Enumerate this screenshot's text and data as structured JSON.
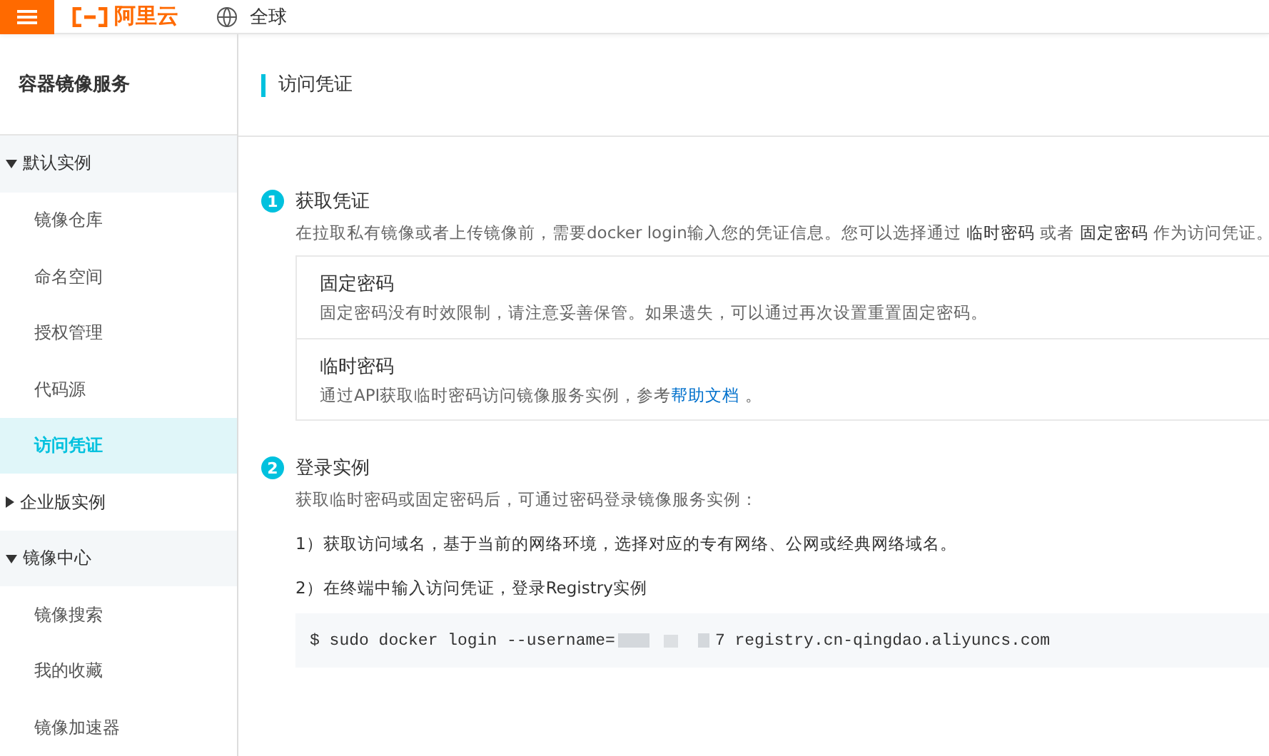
{
  "topbar": {
    "logo": "阿里云",
    "region": "全球"
  },
  "sidebar": {
    "title": "容器镜像服务",
    "groups": [
      {
        "label": "默认实例",
        "expanded": true,
        "children": [
          {
            "label": "镜像仓库",
            "selected": false
          },
          {
            "label": "命名空间",
            "selected": false
          },
          {
            "label": "授权管理",
            "selected": false
          },
          {
            "label": "代码源",
            "selected": false
          },
          {
            "label": "访问凭证",
            "selected": true
          }
        ]
      },
      {
        "label": "企业版实例",
        "expanded": false
      },
      {
        "label": "镜像中心",
        "expanded": true,
        "children": [
          {
            "label": "镜像搜索",
            "selected": false
          },
          {
            "label": "我的收藏",
            "selected": false
          },
          {
            "label": "镜像加速器",
            "selected": false
          }
        ]
      }
    ]
  },
  "page": {
    "title": "访问凭证",
    "step1": {
      "number": "1",
      "title": "获取凭证",
      "description": "在拉取私有镜像或者上传镜像前，需要docker login输入您的凭证信息。您可以选择通过 **临时密码** 或者 **固定密码** 作为访问凭证。",
      "options": [
        {
          "title": "固定密码",
          "text": "固定密码没有时效限制，请注意妥善保管。如果遗失，可以通过再次设置重置固定密码。"
        },
        {
          "title": "临时密码",
          "text": "通过API获取临时密码访问镜像服务实例，参考",
          "link": "帮助文档",
          "after": " 。"
        }
      ]
    },
    "step2": {
      "number": "2",
      "title": "登录实例",
      "description": "获取临时密码或固定密码后，可通过密码登录镜像服务实例：",
      "lines": [
        "1）获取访问域名，基于当前的网络环境，选择对应的专有网络、公网或经典网络域名。",
        "2）在终端中输入访问凭证，登录Registry实例"
      ],
      "command": {
        "prefix": "$ sudo docker login --username=",
        "suffix": "7 registry.cn-qingdao.aliyuncs.com"
      }
    }
  }
}
